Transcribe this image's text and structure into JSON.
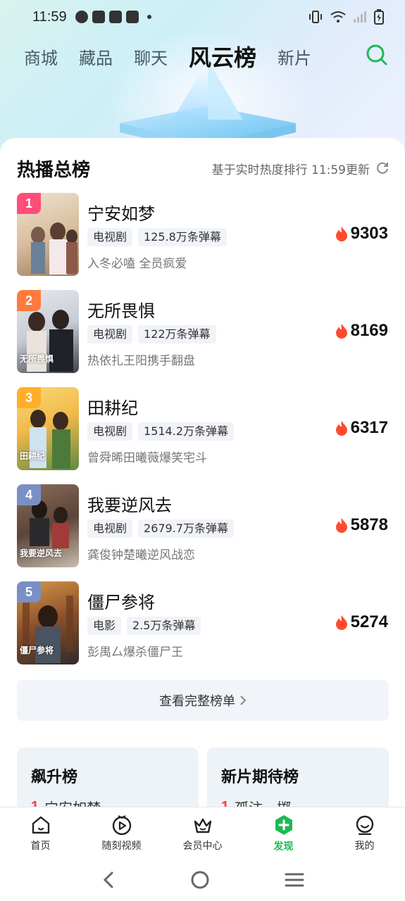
{
  "status_bar": {
    "time": "11:59"
  },
  "top_tabs": [
    {
      "label": "商城",
      "active": false
    },
    {
      "label": "藏品",
      "active": false
    },
    {
      "label": "聊天",
      "active": false
    },
    {
      "label": "风云榜",
      "active": true
    },
    {
      "label": "新片",
      "active": false
    }
  ],
  "board": {
    "title": "热播总榜",
    "subtitle": "基于实时热度排行 11:59更新",
    "items": [
      {
        "rank": "1",
        "name": "宁安如梦",
        "tags": [
          "电视剧",
          "125.8万条弹幕"
        ],
        "desc": "入冬必嗑 全员疯爱",
        "heat": "9303",
        "badge_color": "#ff4d7a",
        "poster_colors": [
          "#e9d7c2",
          "#b8926f"
        ],
        "caption": ""
      },
      {
        "rank": "2",
        "name": "无所畏惧",
        "tags": [
          "电视剧",
          "122万条弹幕"
        ],
        "desc": "热依扎王阳携手翻盘",
        "heat": "8169",
        "badge_color": "#ff7a3d",
        "poster_colors": [
          "#dfe3ea",
          "#40444c"
        ],
        "caption": "无所畏惧"
      },
      {
        "rank": "3",
        "name": "田耕纪",
        "tags": [
          "电视剧",
          "1514.2万条弹幕"
        ],
        "desc": "曾舜晞田曦薇爆笑宅斗",
        "heat": "6317",
        "badge_color": "#ffae2b",
        "poster_colors": [
          "#f6c84a",
          "#4f7d3a"
        ],
        "caption": "田耕纪"
      },
      {
        "rank": "4",
        "name": "我要逆风去",
        "tags": [
          "电视剧",
          "2679.7万条弹幕"
        ],
        "desc": "龚俊钟楚曦逆风战恋",
        "heat": "5878",
        "badge_color": "#7a8fc4",
        "poster_colors": [
          "#6e5647",
          "#2f2620"
        ],
        "caption": "我要逆风去"
      },
      {
        "rank": "5",
        "name": "僵尸参将",
        "tags": [
          "电影",
          "2.5万条弹幕"
        ],
        "desc": "彭禺厶爆杀僵尸王",
        "heat": "5274",
        "badge_color": "#7a8fc4",
        "poster_colors": [
          "#c1793a",
          "#3a2a20"
        ],
        "caption": "僵尸参将"
      }
    ],
    "full_list_label": "查看完整榜单"
  },
  "subboards": [
    {
      "title": "飙升榜",
      "peek_rank": "1",
      "peek_name": "宁安如梦"
    },
    {
      "title": "新片期待榜",
      "peek_rank": "1",
      "peek_name": "孤注一掷"
    }
  ],
  "bottom_nav": [
    {
      "label": "首页",
      "icon": "home-icon",
      "active": false
    },
    {
      "label": "随刻视频",
      "icon": "play-circle-icon",
      "active": false
    },
    {
      "label": "会员中心",
      "icon": "crown-icon",
      "active": false
    },
    {
      "label": "发现",
      "icon": "discover-plus-icon",
      "active": true
    },
    {
      "label": "我的",
      "icon": "profile-icon",
      "active": false
    }
  ],
  "colors": {
    "accent": "#1db954",
    "heat": "#ff4a2e"
  }
}
